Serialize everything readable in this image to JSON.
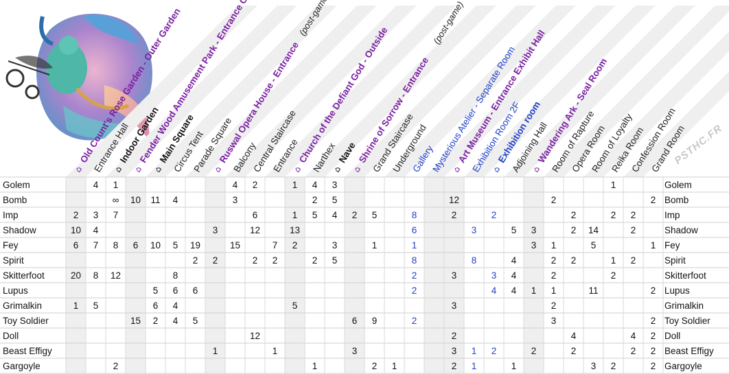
{
  "watermark": "PSTHC.FR",
  "row_label_header": "",
  "columns": [
    {
      "label": "Old Count's Rose Garden - Outer Garden",
      "kind": "area",
      "color": "#7a1fa2"
    },
    {
      "label": "Entrance Hall",
      "kind": "room",
      "color": "#222222"
    },
    {
      "label": "Indoor Garden",
      "kind": "sub",
      "color": "#111111"
    },
    {
      "label": "Fender Wood Amusement Park - Entrance Gate",
      "kind": "area",
      "color": "#7a1fa2"
    },
    {
      "label": "Main Square",
      "kind": "sub",
      "color": "#111111"
    },
    {
      "label": "Circus Tent",
      "kind": "room",
      "color": "#222222"
    },
    {
      "label": "Parade Square",
      "kind": "room",
      "color": "#222222"
    },
    {
      "label": "Ruswal Opera House - Entrance",
      "kind": "area",
      "color": "#7a1fa2",
      "note": "(post-game)"
    },
    {
      "label": "Balcony",
      "kind": "room",
      "color": "#222222"
    },
    {
      "label": "Central Staircase",
      "kind": "room",
      "color": "#222222"
    },
    {
      "label": "Entrance",
      "kind": "room",
      "color": "#222222"
    },
    {
      "label": "Church of the Defiant God - Outside",
      "kind": "area",
      "color": "#7a1fa2"
    },
    {
      "label": "Narthex",
      "kind": "room",
      "color": "#222222"
    },
    {
      "label": "Nave",
      "kind": "sub",
      "color": "#111111"
    },
    {
      "label": "Shrine of Sorrow - Entrance",
      "kind": "area",
      "color": "#7a1fa2",
      "note": "(post-game)"
    },
    {
      "label": "Grand Staircase",
      "kind": "room",
      "color": "#222222"
    },
    {
      "label": "Underground",
      "kind": "room",
      "color": "#222222"
    },
    {
      "label": "Gallery",
      "kind": "blue",
      "color": "#1f3fc8"
    },
    {
      "label": "Mysterious Atelier - Separate Room",
      "kind": "blue",
      "color": "#1f3fc8"
    },
    {
      "label": "Art Museum - Entrance Exhibit Hall",
      "kind": "area",
      "color": "#7a1fa2"
    },
    {
      "label": "Exhibition Room 2F",
      "kind": "blue",
      "color": "#1f3fc8"
    },
    {
      "label": "Exhibition room",
      "kind": "bluebold",
      "color": "#1f3fc8"
    },
    {
      "label": "Adjoining Hall",
      "kind": "room",
      "color": "#222222"
    },
    {
      "label": "Wandering Ark - Seal Room",
      "kind": "area",
      "color": "#7a1fa2"
    },
    {
      "label": "Room of Rapture",
      "kind": "room",
      "color": "#222222"
    },
    {
      "label": "Opera Room",
      "kind": "room",
      "color": "#222222"
    },
    {
      "label": "Room of Loyalty",
      "kind": "room",
      "color": "#222222"
    },
    {
      "label": "Reika Room",
      "kind": "room",
      "color": "#222222"
    },
    {
      "label": "Confession Room",
      "kind": "room",
      "color": "#222222"
    },
    {
      "label": "Grand Room",
      "kind": "room",
      "color": "#222222"
    }
  ],
  "rows": [
    {
      "name": "Golem",
      "cells": [
        "",
        "4",
        "1",
        "",
        "",
        "",
        "",
        "",
        "4",
        "2",
        "",
        "1",
        "4",
        "3",
        "",
        "",
        "",
        "",
        "",
        "",
        "",
        "",
        "",
        "",
        "",
        "",
        "",
        "1",
        "",
        ""
      ]
    },
    {
      "name": "Bomb",
      "cells": [
        "",
        "",
        "∞",
        "10",
        "11",
        "4",
        "",
        "",
        "3",
        "",
        "",
        "",
        "2",
        "5",
        "",
        "",
        "",
        "",
        "",
        "12",
        "",
        "",
        "",
        "",
        "2",
        "",
        "",
        "",
        "",
        "2"
      ]
    },
    {
      "name": "Imp",
      "cells": [
        "2",
        "3",
        "7",
        "",
        "",
        "",
        "",
        "",
        "",
        "6",
        "",
        "1",
        "5",
        "4",
        "2",
        "5",
        "",
        "8",
        "",
        "2",
        "",
        "2",
        "",
        "",
        "",
        "2",
        "",
        "2",
        "2",
        ""
      ]
    },
    {
      "name": "Shadow",
      "cells": [
        "10",
        "4",
        "",
        "",
        "",
        "",
        "",
        "3",
        "",
        "12",
        "",
        "13",
        "",
        "",
        "",
        "",
        "",
        "6",
        "",
        "",
        "3",
        "",
        "5",
        "3",
        "",
        "2",
        "14",
        "",
        "2",
        ""
      ]
    },
    {
      "name": "Fey",
      "cells": [
        "6",
        "7",
        "8",
        "6",
        "10",
        "5",
        "19",
        "",
        "15",
        "",
        "7",
        "2",
        "",
        "3",
        "",
        "1",
        "",
        "1",
        "",
        "",
        "",
        "",
        "",
        "3",
        "1",
        "",
        "5",
        "",
        "",
        "1"
      ]
    },
    {
      "name": "Spirit",
      "cells": [
        "",
        "",
        "",
        "",
        "",
        "",
        "2",
        "2",
        "",
        "2",
        "2",
        "",
        "2",
        "5",
        "",
        "",
        "",
        "8",
        "",
        "",
        "8",
        "",
        "4",
        "",
        "2",
        "2",
        "",
        "1",
        "2",
        ""
      ]
    },
    {
      "name": "Skitterfoot",
      "cells": [
        "20",
        "8",
        "12",
        "",
        "",
        "8",
        "",
        "",
        "",
        "",
        "",
        "",
        "",
        "",
        "",
        "",
        "",
        "2",
        "",
        "3",
        "",
        "3",
        "4",
        "",
        "2",
        "",
        "",
        "2",
        "",
        ""
      ]
    },
    {
      "name": "Lupus",
      "cells": [
        "",
        "",
        "",
        "",
        "5",
        "6",
        "6",
        "",
        "",
        "",
        "",
        "",
        "",
        "",
        "",
        "",
        "",
        "2",
        "",
        "",
        "",
        "4",
        "4",
        "1",
        "1",
        "",
        "11",
        "",
        "",
        "2"
      ]
    },
    {
      "name": "Grimalkin",
      "cells": [
        "1",
        "5",
        "",
        "",
        "6",
        "4",
        "",
        "",
        "",
        "",
        "",
        "5",
        "",
        "",
        "",
        "",
        "",
        "",
        "",
        "3",
        "",
        "",
        "",
        "",
        "2",
        "",
        "",
        "",
        "",
        ""
      ]
    },
    {
      "name": "Toy Soldier",
      "cells": [
        "",
        "",
        "",
        "15",
        "2",
        "4",
        "5",
        "",
        "",
        "",
        "",
        "",
        "",
        "",
        "6",
        "9",
        "",
        "2",
        "",
        "",
        "",
        "",
        "",
        "",
        "3",
        "",
        "",
        "",
        "",
        "2"
      ]
    },
    {
      "name": "Doll",
      "cells": [
        "",
        "",
        "",
        "",
        "",
        "",
        "",
        "",
        "",
        "12",
        "",
        "",
        "",
        "",
        "",
        "",
        "",
        "",
        "",
        "2",
        "",
        "",
        "",
        "",
        "",
        "4",
        "",
        "",
        "4",
        "2"
      ]
    },
    {
      "name": "Beast Effigy",
      "cells": [
        "",
        "",
        "",
        "",
        "",
        "",
        "",
        "1",
        "",
        "",
        "1",
        "",
        "",
        "",
        "3",
        "",
        "",
        "",
        "",
        "3",
        "1",
        "2",
        "",
        "2",
        "",
        "2",
        "",
        "",
        "2",
        "2"
      ]
    },
    {
      "name": "Gargoyle",
      "cells": [
        "",
        "",
        "2",
        "",
        "",
        "",
        "",
        "",
        "",
        "",
        "",
        "",
        "1",
        "",
        "",
        "2",
        "1",
        "",
        "",
        "2",
        "1",
        "",
        "1",
        "",
        "",
        "",
        "3",
        "2",
        "",
        "2"
      ]
    }
  ],
  "blue_columns": [
    17,
    20,
    21
  ]
}
